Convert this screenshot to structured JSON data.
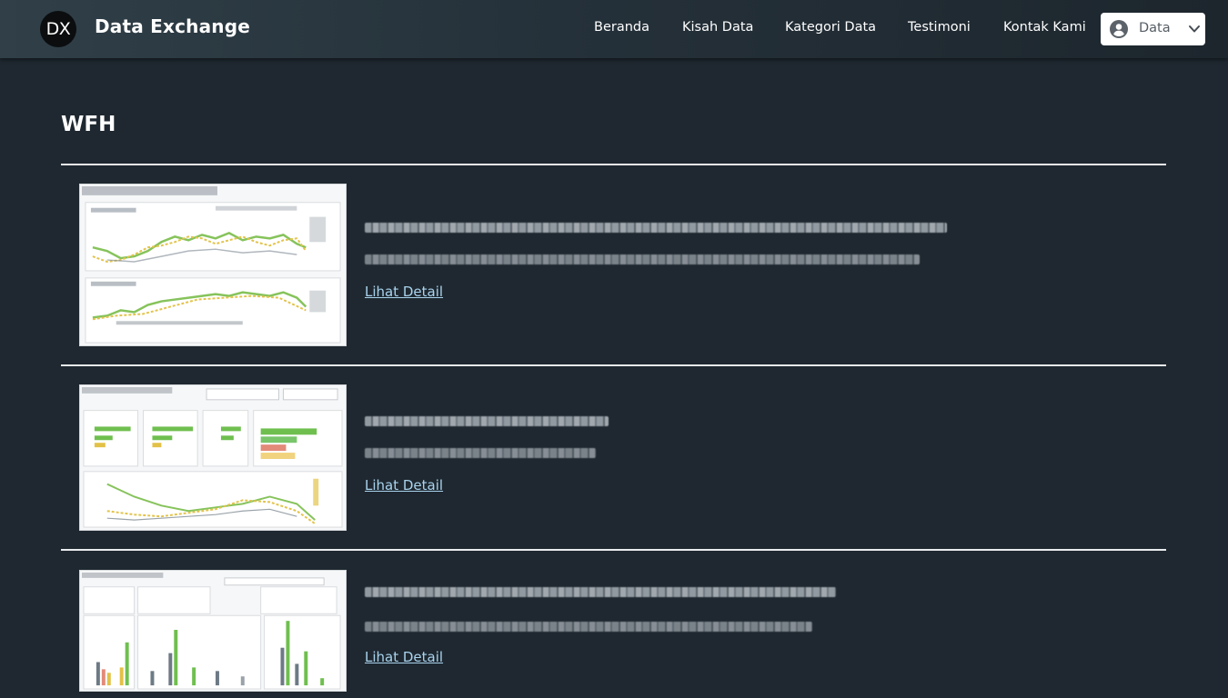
{
  "brand": {
    "logo_text": "DX",
    "name": "Data Exchange"
  },
  "nav": {
    "items": [
      {
        "label": "Beranda"
      },
      {
        "label": "Kisah Data"
      },
      {
        "label": "Kategori Data"
      },
      {
        "label": "Testimoni"
      },
      {
        "label": "Kontak Kami"
      }
    ],
    "data_button_label": "Data"
  },
  "page": {
    "title": "WFH"
  },
  "stories": [
    {
      "link_label": "Lihat Detail",
      "thumbnail_icon": "dashboard-line-chart-thumbnail"
    },
    {
      "link_label": "Lihat Detail",
      "thumbnail_icon": "dashboard-bar-chart-thumbnail"
    },
    {
      "link_label": "Lihat Detail",
      "thumbnail_icon": "dashboard-column-chart-thumbnail"
    }
  ],
  "colors": {
    "background": "#1f2830",
    "navbar": "#2b3942",
    "link": "#a9d3ee",
    "divider": "#e9ecee"
  }
}
